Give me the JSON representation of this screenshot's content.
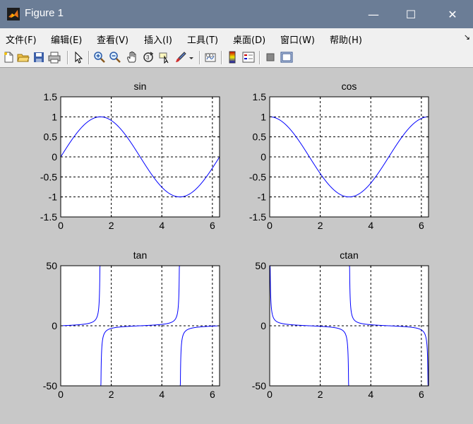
{
  "window": {
    "title": "Figure 1",
    "minimize_glyph": "—",
    "maximize_glyph": "☐",
    "close_glyph": "✕"
  },
  "menu": [
    {
      "label": "文件(F)",
      "name": "menu-file"
    },
    {
      "label": "编辑(E)",
      "name": "menu-edit"
    },
    {
      "label": "查看(V)",
      "name": "menu-view"
    },
    {
      "label": "插入(I)",
      "name": "menu-insert"
    },
    {
      "label": "工具(T)",
      "name": "menu-tools"
    },
    {
      "label": "桌面(D)",
      "name": "menu-desktop"
    },
    {
      "label": "窗口(W)",
      "name": "menu-window"
    },
    {
      "label": "帮助(H)",
      "name": "menu-help"
    }
  ],
  "toolbar": {
    "icons": [
      "new-figure-icon",
      "open-file-icon",
      "save-icon",
      "print-icon",
      "edit-plot-arrow-icon",
      "zoom-in-icon",
      "zoom-out-icon",
      "pan-hand-icon",
      "rotate-3d-icon",
      "data-cursor-icon",
      "brush-icon",
      "brush-dropdown-icon",
      "link-plot-icon",
      "colorbar-icon",
      "legend-icon",
      "hide-plot-tools-icon",
      "show-plot-tools-icon"
    ]
  },
  "colors": {
    "titlebar": "#6b7d96",
    "line": "#0000ff",
    "figure_bg": "#c8c8c8"
  },
  "chart_data": [
    {
      "type": "line",
      "title": "sin",
      "function": "sin(x)",
      "x_range": [
        0,
        6.2832
      ],
      "xlim": [
        0,
        6.2832
      ],
      "ylim": [
        -1.5,
        1.5
      ],
      "xticks": [
        0,
        2,
        4,
        6
      ],
      "yticks": [
        -1.5,
        -1,
        -0.5,
        0,
        0.5,
        1,
        1.5
      ],
      "ytick_labels": [
        "-1.5",
        "-1",
        "-0.5",
        "0",
        "0.5",
        "1",
        "1.5"
      ],
      "grid": true,
      "sample_points": {
        "x": [
          0,
          0.7854,
          1.5708,
          2.3562,
          3.1416,
          3.927,
          4.7124,
          5.4978,
          6.2832
        ],
        "y": [
          0,
          0.707,
          1,
          0.707,
          0,
          -0.707,
          -1,
          -0.707,
          0
        ]
      }
    },
    {
      "type": "line",
      "title": "cos",
      "function": "cos(x)",
      "x_range": [
        0,
        6.2832
      ],
      "xlim": [
        0,
        6.2832
      ],
      "ylim": [
        -1.5,
        1.5
      ],
      "xticks": [
        0,
        2,
        4,
        6
      ],
      "yticks": [
        -1.5,
        -1,
        -0.5,
        0,
        0.5,
        1,
        1.5
      ],
      "ytick_labels": [
        "-1.5",
        "-1",
        "-0.5",
        "0",
        "0.5",
        "1",
        "1.5"
      ],
      "grid": true,
      "sample_points": {
        "x": [
          0,
          0.7854,
          1.5708,
          2.3562,
          3.1416,
          3.927,
          4.7124,
          5.4978,
          6.2832
        ],
        "y": [
          1,
          0.707,
          0,
          -0.707,
          -1,
          -0.707,
          0,
          0.707,
          1
        ]
      }
    },
    {
      "type": "line",
      "title": "tan",
      "function": "tan(x)",
      "x_range": [
        0,
        6.2832
      ],
      "xlim": [
        0,
        6.2832
      ],
      "ylim": [
        -50,
        50
      ],
      "xticks": [
        0,
        2,
        4,
        6
      ],
      "yticks": [
        -50,
        0,
        50
      ],
      "ytick_labels": [
        "-50",
        "0",
        "50"
      ],
      "grid": true,
      "sample_points": {
        "x": [
          0,
          0.7854,
          1.5,
          1.55,
          1.59,
          1.64,
          2.3562,
          3.1416,
          3.927,
          4.64,
          4.69,
          4.73,
          4.78,
          5.4978,
          6.2832
        ],
        "y": [
          0,
          1,
          14.1,
          48.1,
          -50,
          -14.5,
          -1,
          0,
          1,
          13.8,
          43.4,
          -50,
          -14.5,
          -1,
          0
        ]
      }
    },
    {
      "type": "line",
      "title": "ctan",
      "function": "cot(x)",
      "x_range": [
        0.0001,
        6.2831
      ],
      "xlim": [
        0,
        6.2832
      ],
      "ylim": [
        -50,
        50
      ],
      "xticks": [
        0,
        2,
        4,
        6
      ],
      "yticks": [
        -50,
        0,
        50
      ],
      "ytick_labels": [
        "-50",
        "0",
        "50"
      ],
      "grid": true,
      "sample_points": {
        "x": [
          0.02,
          0.1,
          0.7854,
          1.5708,
          2.3562,
          3.05,
          3.12,
          3.16,
          3.23,
          3.927,
          4.7124,
          5.4978,
          6.18,
          6.26
        ],
        "y": [
          50,
          9.97,
          1,
          0,
          -1,
          -10.9,
          -46.5,
          50,
          11.0,
          1,
          0,
          -1,
          -9.6,
          -43.5
        ]
      }
    }
  ]
}
